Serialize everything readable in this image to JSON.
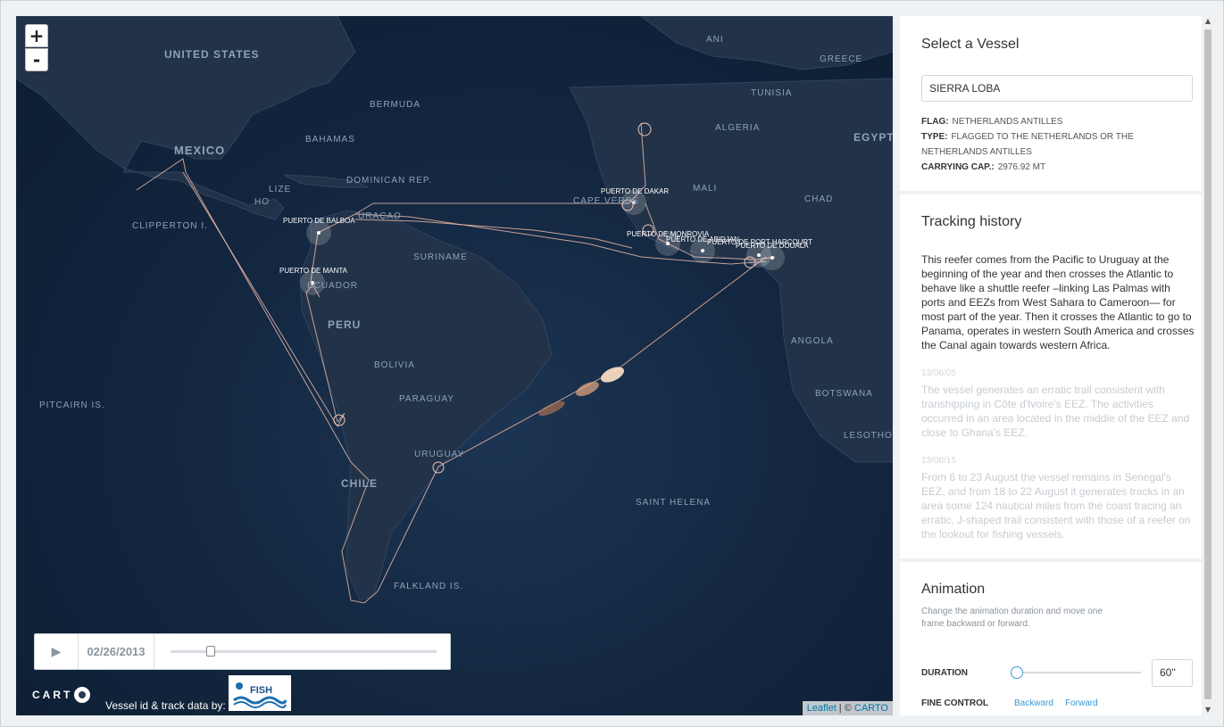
{
  "map": {
    "zoom_in": "+",
    "zoom_out": "-",
    "country_labels": [
      {
        "text": "UNITED STATES",
        "size": "large"
      },
      {
        "text": "MEXICO",
        "size": "large"
      },
      {
        "text": "BERMUDA",
        "size": "small"
      },
      {
        "text": "BAHAMAS",
        "size": "small"
      },
      {
        "text": "DOMINICAN REP.",
        "size": "small"
      },
      {
        "text": "CLIPPERTON I.",
        "size": "small"
      },
      {
        "text": "LIZE",
        "size": "small"
      },
      {
        "text": "HO",
        "size": "small"
      },
      {
        "text": "URAÇAO",
        "size": "small"
      },
      {
        "text": "SURINAME",
        "size": "small"
      },
      {
        "text": "ECUADOR",
        "size": "small"
      },
      {
        "text": "PERU",
        "size": "large"
      },
      {
        "text": "BOLIVIA",
        "size": "small"
      },
      {
        "text": "PARAGUAY",
        "size": "small"
      },
      {
        "text": "PITCAIRN IS.",
        "size": "small"
      },
      {
        "text": "URUGUAY",
        "size": "small"
      },
      {
        "text": "CHILE",
        "size": "large"
      },
      {
        "text": "FALKLAND IS.",
        "size": "small"
      },
      {
        "text": "ANI",
        "size": "small"
      },
      {
        "text": "GREECE",
        "size": "small"
      },
      {
        "text": "TUNISIA",
        "size": "small"
      },
      {
        "text": "ALGERIA",
        "size": "small"
      },
      {
        "text": "EGYPT",
        "size": "large"
      },
      {
        "text": "MALI",
        "size": "small"
      },
      {
        "text": "CHAD",
        "size": "small"
      },
      {
        "text": "CAPE VERDE",
        "size": "small"
      },
      {
        "text": "ANGOLA",
        "size": "small"
      },
      {
        "text": "BOTSWANA",
        "size": "small"
      },
      {
        "text": "LESOTHO",
        "size": "small"
      },
      {
        "text": "SAINT HELENA",
        "size": "small"
      }
    ],
    "ports": [
      "PUERTO DE BALBOA",
      "PUERTO DE MANTA",
      "PUERTO DE DAKAR",
      "PUERTO DE MONROVIA",
      "PUERTO DE ABIDJAN",
      "PUERTO DE PORT HARCOURT",
      "PUERTO DE DOUALA"
    ],
    "colors": {
      "track": "#e8b6a4",
      "ocean": "#132740",
      "land": "#233348",
      "hotspot": "#ffe2c8"
    },
    "timebar": {
      "play_icon": "▶",
      "date": "02/26/2013",
      "progress_fraction": 0.14
    },
    "carto_logo": "CART",
    "credit": "Vessel id & track data by:",
    "partner_logo": "FISH SPECTRUM",
    "attribution": {
      "leaflet": "Leaflet",
      "separator": " | © ",
      "carto": "CARTO"
    }
  },
  "sidebar": {
    "vessel": {
      "title": "Select a Vessel",
      "selected": "SIERRA LOBA",
      "flag_label": "FLAG:",
      "flag_value": "NETHERLANDS ANTILLES",
      "type_label": "TYPE:",
      "type_value": "FLAGGED TO THE NETHERLANDS OR THE NETHERLANDS ANTILLES",
      "capacity_label": "CARRYING CAP.:",
      "capacity_value": "2976.92 MT"
    },
    "history": {
      "title": "Tracking history",
      "intro": "This reefer comes from the Pacific to Uruguay at the beginning of the year and then crosses the Atlantic to behave like a shuttle reefer –linking Las Palmas with ports and EEZs from West Sahara to Cameroon— for most part of the year. Then it crosses the Atlantic to go to Panama, operates in western South America and crosses the Canal again towards western Africa.",
      "entries": [
        {
          "date": "13/06/05",
          "text": "The vessel generates an erratic trail consistent with transhipping in Côte d'Ivoire's EEZ. The activities occurred in an area located in the middle of the EEZ and close to Ghana's EEZ."
        },
        {
          "date": "13/08/15",
          "text": "From 6 to 23 August the vessel remains in Senegal's EEZ, and from 18 to 22 August it generates tracks in an area some 124 nautical miles from the coast tracing an erratic, J-shaped trail consistent with those of a reefer on the lookout for fishing vessels."
        }
      ]
    },
    "animation": {
      "title": "Animation",
      "description": "Change the animation duration and move one frame backward or forward.",
      "duration_label": "DURATION",
      "duration_value": "60''",
      "duration_fraction": 0.0,
      "fine_label": "FINE CONTROL",
      "backward": "Backward",
      "forward": "Forward"
    }
  }
}
